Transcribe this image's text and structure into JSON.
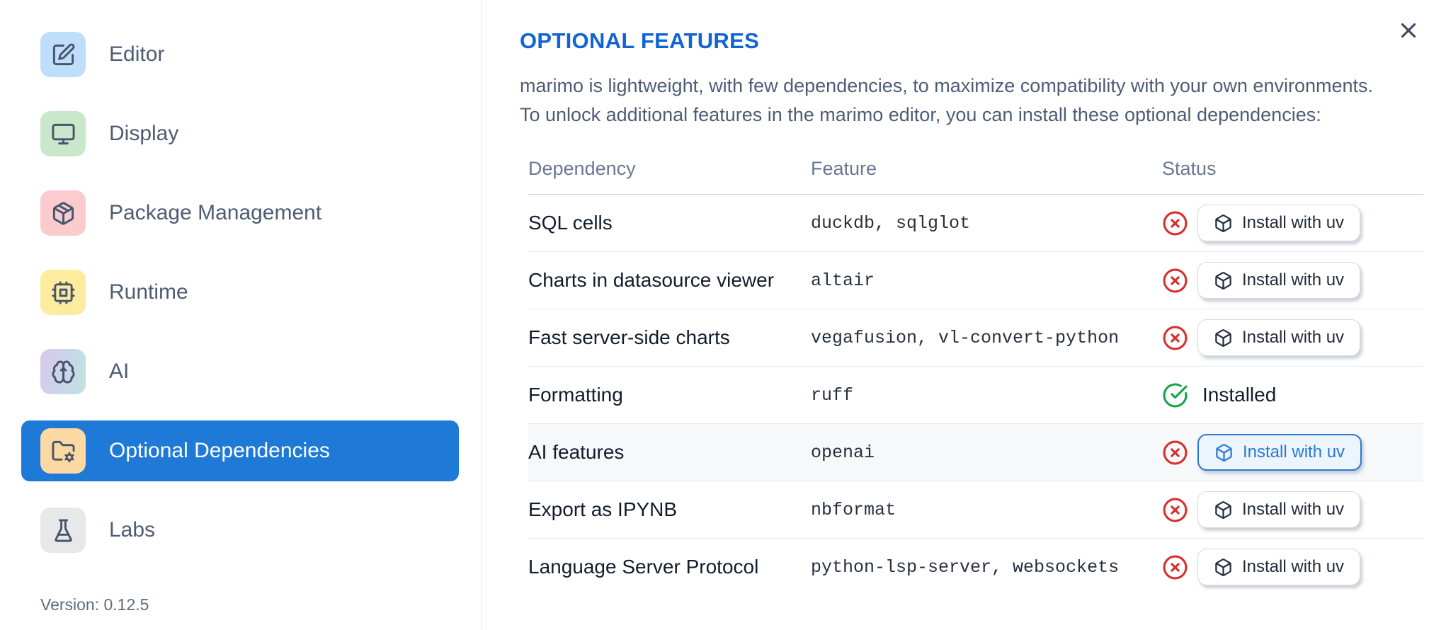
{
  "colors": {
    "accent_blue": "#1064d4",
    "selected_blue": "#1e7ad6",
    "button_blue": "#2b79d2",
    "error_red": "#d92f2f",
    "success_green": "#17a24b"
  },
  "sidebar": {
    "items": [
      {
        "id": "editor",
        "label": "Editor",
        "icon": "edit",
        "tile_color": "#bfdefb",
        "selected": false
      },
      {
        "id": "display",
        "label": "Display",
        "icon": "monitor",
        "tile_color": "#c9e7cb",
        "selected": false
      },
      {
        "id": "package-management",
        "label": "Package Management",
        "icon": "package",
        "tile_color": "#fbcbce",
        "selected": false
      },
      {
        "id": "runtime",
        "label": "Runtime",
        "icon": "cpu",
        "tile_color": "#fdeb9e",
        "selected": false
      },
      {
        "id": "ai",
        "label": "AI",
        "icon": "brain",
        "tile_gradient": {
          "from": "#d8c8ef",
          "to": "#bfe2e2"
        },
        "selected": false
      },
      {
        "id": "optional-dependencies",
        "label": "Optional Dependencies",
        "icon": "folder-cog",
        "tile_color": "#fcd9a2",
        "selected": true
      },
      {
        "id": "labs",
        "label": "Labs",
        "icon": "flask",
        "tile_color": "#e7e8ea",
        "selected": false
      }
    ],
    "version_label": "Version: 0.12.5"
  },
  "main": {
    "title": "OPTIONAL FEATURES",
    "description_line1": "marimo is lightweight, with few dependencies, to maximize compatibility with your own environments.",
    "description_line2": "To unlock additional features in the marimo editor, you can install these optional dependencies:",
    "table": {
      "columns": [
        "Dependency",
        "Feature",
        "Status"
      ],
      "rows": [
        {
          "dependency": "SQL cells",
          "feature": "duckdb, sqlglot",
          "installed": false,
          "action_label": "Install with uv",
          "highlighted": false
        },
        {
          "dependency": "Charts in datasource viewer",
          "feature": "altair",
          "installed": false,
          "action_label": "Install with uv",
          "highlighted": false
        },
        {
          "dependency": "Fast server-side charts",
          "feature": "vegafusion, vl-convert-python",
          "installed": false,
          "action_label": "Install with uv",
          "highlighted": false
        },
        {
          "dependency": "Formatting",
          "feature": "ruff",
          "installed": true,
          "status_label": "Installed",
          "highlighted": false
        },
        {
          "dependency": "AI features",
          "feature": "openai",
          "installed": false,
          "action_label": "Install with uv",
          "highlighted": true
        },
        {
          "dependency": "Export as IPYNB",
          "feature": "nbformat",
          "installed": false,
          "action_label": "Install with uv",
          "highlighted": false
        },
        {
          "dependency": "Language Server Protocol",
          "feature": "python-lsp-server, websockets",
          "installed": false,
          "action_label": "Install with uv",
          "highlighted": false
        }
      ]
    }
  }
}
